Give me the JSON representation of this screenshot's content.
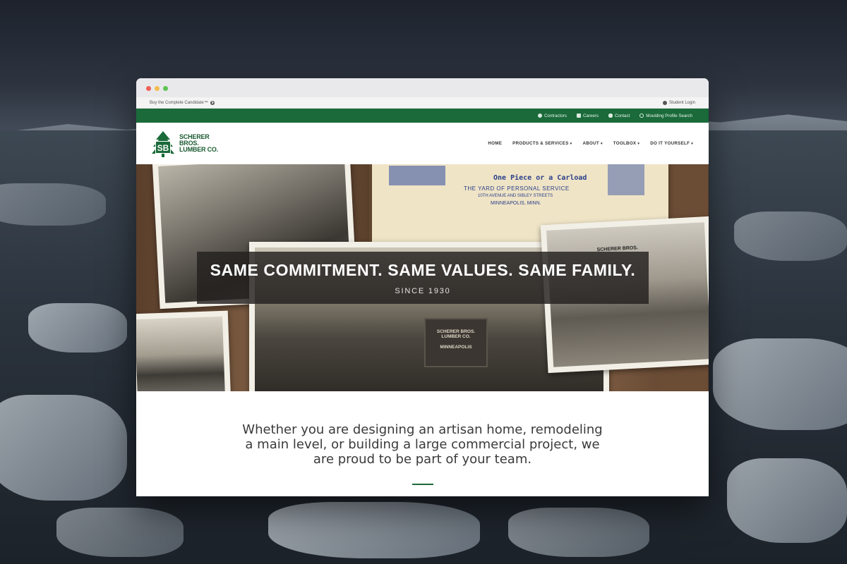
{
  "utility_bar": {
    "left_link": "Buy the Complete Candidate™",
    "right_link": "Student Login"
  },
  "green_bar": {
    "items": [
      {
        "label": "Contractors",
        "icon": "user-icon"
      },
      {
        "label": "Careers",
        "icon": "edit-icon"
      },
      {
        "label": "Contact",
        "icon": "chat-icon"
      },
      {
        "label": "Moulding Profile Search",
        "icon": "search-icon"
      }
    ]
  },
  "logo": {
    "line1": "SCHERER",
    "line2": "BROS.",
    "line3": "LUMBER CO.",
    "mark": "SB"
  },
  "nav": {
    "items": [
      {
        "label": "HOME",
        "dropdown": false
      },
      {
        "label": "PRODUCTS & SERVICES",
        "dropdown": true
      },
      {
        "label": "ABOUT",
        "dropdown": true
      },
      {
        "label": "TOOLBOX",
        "dropdown": true
      },
      {
        "label": "DO IT YOURSELF",
        "dropdown": true
      }
    ]
  },
  "hero": {
    "title": "SAME COMMITMENT. SAME VALUES. SAME FAMILY.",
    "subtitle": "SINCE 1930",
    "letterhead_line1": "One Piece or a Carload",
    "letterhead_line2": "THE YARD OF PERSONAL SERVICE",
    "letterhead_line3": "10TH AVENUE AND SIBLEY STREETS",
    "letterhead_line4": "MINNEAPOLIS, MINN.",
    "truck_text1": "SCHERER BROS.",
    "truck_text2": "LUMBER CO.",
    "truck_text3": "MINNEAPOLIS",
    "storefront_sign": "SCHERER BROS."
  },
  "content": {
    "tagline": "Whether you are designing an artisan home, remodeling a main level, or building a large commercial project, we are proud to be part of your team."
  },
  "colors": {
    "brand_green": "#1a6a3a",
    "hero_overlay": "#23201e"
  }
}
